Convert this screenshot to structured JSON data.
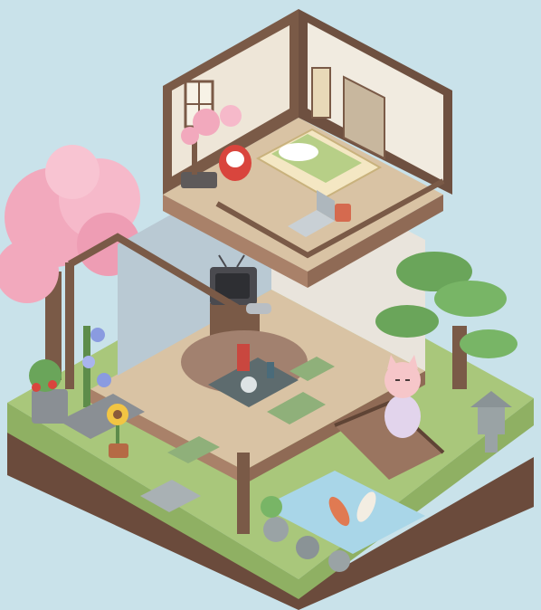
{
  "scene": {
    "palette": {
      "sky": "#c9e2ea",
      "wood_dark": "#7a5a47",
      "wood_mid": "#a98169",
      "wood_light": "#c9a58a",
      "floor": "#d9c3a4",
      "grass": "#a9c77b",
      "soil": "#6b4b3c",
      "blossom": "#f2a9bd",
      "pine": "#6aa55a",
      "water": "#a9d6e8",
      "stone": "#9aa3a5",
      "koi": "#e07a52",
      "fox": "#f6c6c9"
    },
    "icons": [
      "cherry-blossom-tree-icon",
      "bonsai-icon",
      "daruma-icon",
      "futon-bed-icon",
      "laptop-icon",
      "tea-mug-icon",
      "scroll-painting-icon",
      "crt-tv-icon",
      "game-controller-icon",
      "tea-set-icon",
      "pine-tree-icon",
      "stone-lantern-icon",
      "koi-pond-icon",
      "wooden-bridge-icon",
      "fox-character-icon",
      "sunflower-icon",
      "strawberry-plant-icon",
      "morning-glory-icon"
    ]
  }
}
